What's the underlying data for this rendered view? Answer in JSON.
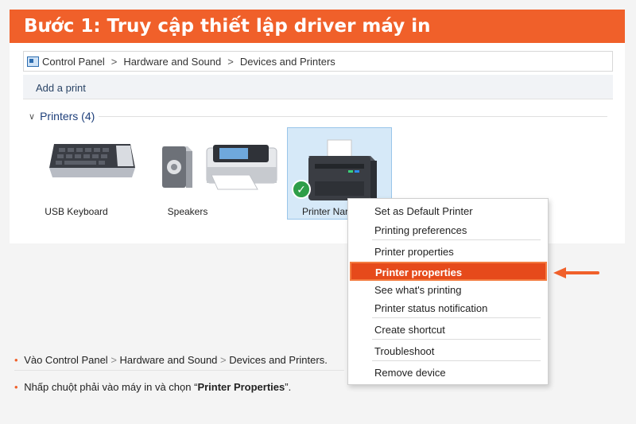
{
  "banner": {
    "title": "Bước 1: Truy cập thiết lập driver máy in"
  },
  "breadcrumb": {
    "items": [
      "Control Panel",
      "Hardware and Sound",
      "Devices and Printers"
    ],
    "separator": ">"
  },
  "toolbar": {
    "add_printer": "Add a print"
  },
  "group": {
    "chevron": "∨",
    "title": "Printers (4)"
  },
  "devices": [
    {
      "label": "USB Keyboard",
      "icon": "keyboard-icon"
    },
    {
      "label": "Speakers",
      "icon": "speakers-icon"
    },
    {
      "label": "",
      "icon": "printer-icon"
    },
    {
      "label": "Printer Nar",
      "icon": "receipt-printer-icon"
    }
  ],
  "default_check": "✓",
  "context_menu": {
    "items": [
      "Set as Default Printer",
      "Printing preferences",
      "Printer properties",
      "Printer properties",
      "See what's printing",
      "Printer status notification",
      "Create shortcut",
      "Troubleshoot",
      "Remove device"
    ],
    "highlighted_index": 3
  },
  "instructions": {
    "line1": {
      "lead": "Vào Control Panel",
      "sep": ">",
      "mid": "Hardware and Sound",
      "end": "Devices and Printers."
    },
    "line2": {
      "prefix": "Nhấp chuột phải vào máy in và chọn “",
      "bold": "Printer Properties",
      "suffix": "”."
    },
    "bullet": "•"
  },
  "colors": {
    "accent": "#f0602a",
    "highlight": "#e64a1b",
    "selection": "#d6e9f8"
  }
}
